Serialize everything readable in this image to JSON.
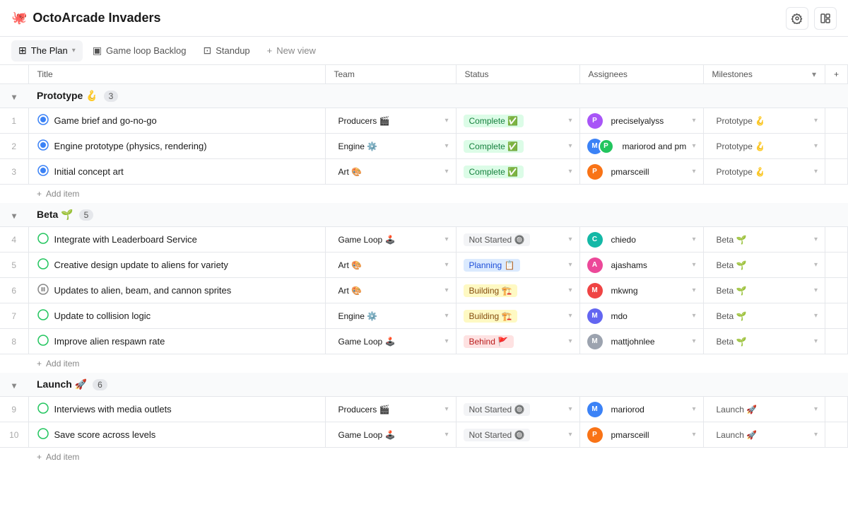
{
  "app": {
    "icon": "🐙",
    "title": "OctoArcade Invaders",
    "settings_label": "⚙",
    "layout_label": "⊞"
  },
  "tabs": [
    {
      "id": "plan",
      "icon": "⊞",
      "label": "The Plan",
      "active": true,
      "has_chevron": true
    },
    {
      "id": "backlog",
      "icon": "▣",
      "label": "Game loop Backlog",
      "active": false,
      "has_chevron": false
    },
    {
      "id": "standup",
      "icon": "⊡",
      "label": "Standup",
      "active": false,
      "has_chevron": false
    },
    {
      "id": "new",
      "icon": "+",
      "label": "New view",
      "active": false,
      "has_chevron": false
    }
  ],
  "columns": {
    "num": "",
    "title": "Title",
    "team": "Team",
    "status": "Status",
    "assignees": "Assignees",
    "milestones": "Milestones"
  },
  "sections": [
    {
      "id": "prototype",
      "label": "Prototype 🪝",
      "emoji": "🪝",
      "count": 3,
      "collapsed": false,
      "rows": [
        {
          "num": 1,
          "status_icon": "🔵",
          "status_icon_type": "complete-circle",
          "title": "Game brief and go-no-go",
          "team": "Producers 🎬",
          "status": "Complete ✅",
          "status_type": "complete",
          "assignees": [
            {
              "initials": "P",
              "color": "av-purple",
              "name": "preciselyalyss"
            }
          ],
          "assignees_label": "preciselyalyss",
          "milestone": "Prototype 🪝"
        },
        {
          "num": 2,
          "status_icon": "🔵",
          "status_icon_type": "complete-circle",
          "title": "Engine prototype (physics, rendering)",
          "team": "Engine ⚙️",
          "status": "Complete ✅",
          "status_type": "complete",
          "assignees": [
            {
              "initials": "M",
              "color": "av-blue",
              "name": "mariorod"
            },
            {
              "initials": "P",
              "color": "av-green",
              "name": "pm"
            }
          ],
          "assignees_label": "mariorod and pm",
          "milestone": "Prototype 🪝"
        },
        {
          "num": 3,
          "status_icon": "🔵",
          "status_icon_type": "complete-circle",
          "title": "Initial concept art",
          "team": "Art 🎨",
          "status": "Complete ✅",
          "status_type": "complete",
          "assignees": [
            {
              "initials": "P",
              "color": "av-orange",
              "name": "pmarsceill"
            }
          ],
          "assignees_label": "pmarsceill",
          "milestone": "Prototype 🪝"
        }
      ]
    },
    {
      "id": "beta",
      "label": "Beta 🌱",
      "emoji": "🌱",
      "count": 5,
      "collapsed": false,
      "rows": [
        {
          "num": 4,
          "status_icon": "🟢",
          "status_icon_type": "open-circle",
          "title": "Integrate with Leaderboard Service",
          "team": "Game Loop 🕹️",
          "status": "Not Started 🔘",
          "status_type": "not-started",
          "assignees": [
            {
              "initials": "C",
              "color": "av-teal",
              "name": "chiedo"
            }
          ],
          "assignees_label": "chiedo",
          "milestone": "Beta 🌱"
        },
        {
          "num": 5,
          "status_icon": "🟢",
          "status_icon_type": "open-circle",
          "title": "Creative design update to aliens for variety",
          "team": "Art 🎨",
          "status": "Planning 📋",
          "status_type": "planning",
          "assignees": [
            {
              "initials": "A",
              "color": "av-pink",
              "name": "ajashams"
            }
          ],
          "assignees_label": "ajashams",
          "milestone": "Beta 🌱"
        },
        {
          "num": 6,
          "status_icon": "⏸",
          "status_icon_type": "paused",
          "title": "Updates to alien, beam, and cannon sprites",
          "team": "Art 🎨",
          "status": "Building 🏗️",
          "status_type": "building",
          "assignees": [
            {
              "initials": "M",
              "color": "av-red",
              "name": "mkwng"
            }
          ],
          "assignees_label": "mkwng",
          "milestone": "Beta 🌱"
        },
        {
          "num": 7,
          "status_icon": "🟢",
          "status_icon_type": "open-circle",
          "title": "Update to collision logic",
          "team": "Engine ⚙️",
          "status": "Building 🏗️",
          "status_type": "building",
          "assignees": [
            {
              "initials": "M",
              "color": "av-indigo",
              "name": "mdo"
            }
          ],
          "assignees_label": "mdo",
          "milestone": "Beta 🌱"
        },
        {
          "num": 8,
          "status_icon": "🟢",
          "status_icon_type": "open-circle",
          "title": "Improve alien respawn rate",
          "team": "Game Loop 🕹️",
          "status": "Behind 🚩",
          "status_type": "behind",
          "assignees": [
            {
              "initials": "M",
              "color": "av-gray",
              "name": "mattjohnlee"
            }
          ],
          "assignees_label": "mattjohnlee",
          "milestone": "Beta 🌱"
        }
      ]
    },
    {
      "id": "launch",
      "label": "Launch 🚀",
      "emoji": "🚀",
      "count": 6,
      "collapsed": false,
      "rows": [
        {
          "num": 9,
          "status_icon": "🟢",
          "status_icon_type": "open-circle",
          "title": "Interviews with media outlets",
          "team": "Producers 🎬",
          "status": "Not Started 🔘",
          "status_type": "not-started",
          "assignees": [
            {
              "initials": "M",
              "color": "av-blue",
              "name": "mariorod"
            }
          ],
          "assignees_label": "mariorod",
          "milestone": "Launch 🚀"
        },
        {
          "num": 10,
          "status_icon": "🟢",
          "status_icon_type": "open-circle",
          "title": "Save score across levels",
          "team": "Game Loop 🕹️",
          "status": "Not Started 🔘",
          "status_type": "not-started",
          "assignees": [
            {
              "initials": "P",
              "color": "av-orange",
              "name": "pmarsceill"
            }
          ],
          "assignees_label": "pmarsceill",
          "milestone": "Launch 🚀"
        }
      ]
    }
  ]
}
